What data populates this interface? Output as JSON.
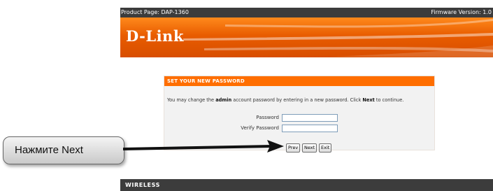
{
  "topbar": {
    "product": "Product Page: DAP-1360",
    "firmware": "Firmware Version: 1.0"
  },
  "header": {
    "logo": "D-Link"
  },
  "panel": {
    "title": "SET YOUR NEW PASSWORD",
    "desc": {
      "part1": "You may change the ",
      "bold1": "admin",
      "part2": " account password by entering in a new password. Click ",
      "bold2": "Next",
      "part3": " to continue."
    },
    "fields": {
      "password_label": "Password",
      "password_value": "",
      "verify_label": "Verify Password",
      "verify_value": ""
    },
    "buttons": {
      "prev": "Prev",
      "next": "Next",
      "exit": "Exit"
    }
  },
  "callout": {
    "text": "Нажмите Next"
  },
  "footer": {
    "label": "WIRELESS"
  },
  "colors": {
    "accent": "#ff6e00",
    "bar": "#3c3c3c",
    "panel_bg": "#f2f2f2"
  }
}
